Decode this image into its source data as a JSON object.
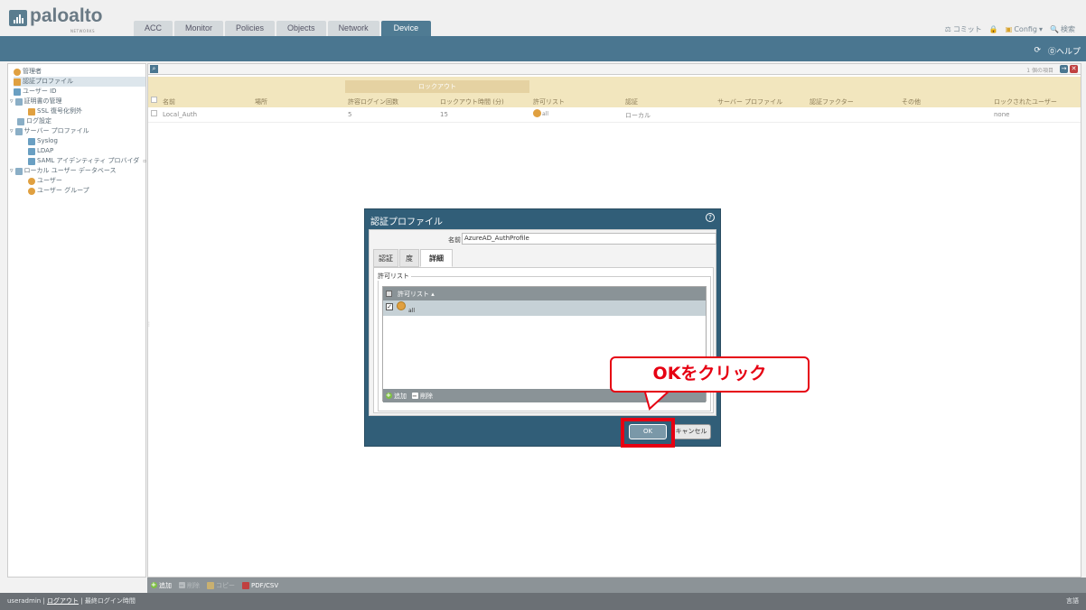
{
  "brand": {
    "name": "paloalto",
    "sub": "NETWORKS"
  },
  "tabs": [
    "ACC",
    "Monitor",
    "Policies",
    "Objects",
    "Network",
    "Device"
  ],
  "active_tab": "Device",
  "toplinks": {
    "commit": "コミット",
    "config": "Config",
    "search": "検索"
  },
  "bluebar": {
    "help": "ヘルプ"
  },
  "sidebar": {
    "items": [
      {
        "label": "管理者"
      },
      {
        "label": "認証プロファイル"
      },
      {
        "label": "ユーザー ID"
      },
      {
        "label": "証明書の管理"
      },
      {
        "label": "SSL 復号化例外"
      },
      {
        "label": "ログ設定"
      },
      {
        "label": "サーバー プロファイル"
      },
      {
        "label": "Syslog"
      },
      {
        "label": "LDAP"
      },
      {
        "label": "SAML アイデンティティ プロバイダ"
      },
      {
        "label": "ローカル ユーザー データベース"
      },
      {
        "label": "ユーザー"
      },
      {
        "label": "ユーザー グループ"
      }
    ]
  },
  "table": {
    "count": "1 個の項目",
    "group_label": "ロックアウト",
    "headers": [
      "名前",
      "場所",
      "許容ログイン回数",
      "ロックアウト時間 (分)",
      "許可リスト",
      "認証",
      "サーバー プロファイル",
      "認証ファクター",
      "その他",
      "ロックされたユーザー"
    ],
    "rows": [
      {
        "name": "Local_Auth",
        "location": "",
        "failed_attempts": "5",
        "lockout_time": "15",
        "allow_list": "all",
        "auth": "ローカル",
        "server_profile": "",
        "factors": "",
        "other": "",
        "locked_users": "none"
      }
    ]
  },
  "bottombar": {
    "add": "追加",
    "delete": "削除",
    "copy": "コピー",
    "pdf": "PDF/CSV"
  },
  "footer": {
    "user": "useradmin",
    "logout": "ログアウト",
    "last_login": "最終ログイン時間",
    "lang": "言語"
  },
  "dialog": {
    "title": "認証プロファイル",
    "name_label": "名前",
    "name_value": "AzureAD_AuthProfile",
    "tabs": [
      "認証",
      "度",
      "詳細"
    ],
    "active_tab": "詳細",
    "section_label": "許可リスト",
    "grid_header": "許可リスト",
    "grid_rows": [
      {
        "value": "all",
        "checked": true
      }
    ],
    "grid_add": "追加",
    "grid_delete": "削除",
    "ok": "OK",
    "cancel": "キャンセル"
  },
  "callout": {
    "text": "OKをクリック"
  },
  "colors": {
    "accent": "#315e78",
    "highlight": "#e60012",
    "header_bar": "#4a7690",
    "table_head": "#f2e6be"
  }
}
